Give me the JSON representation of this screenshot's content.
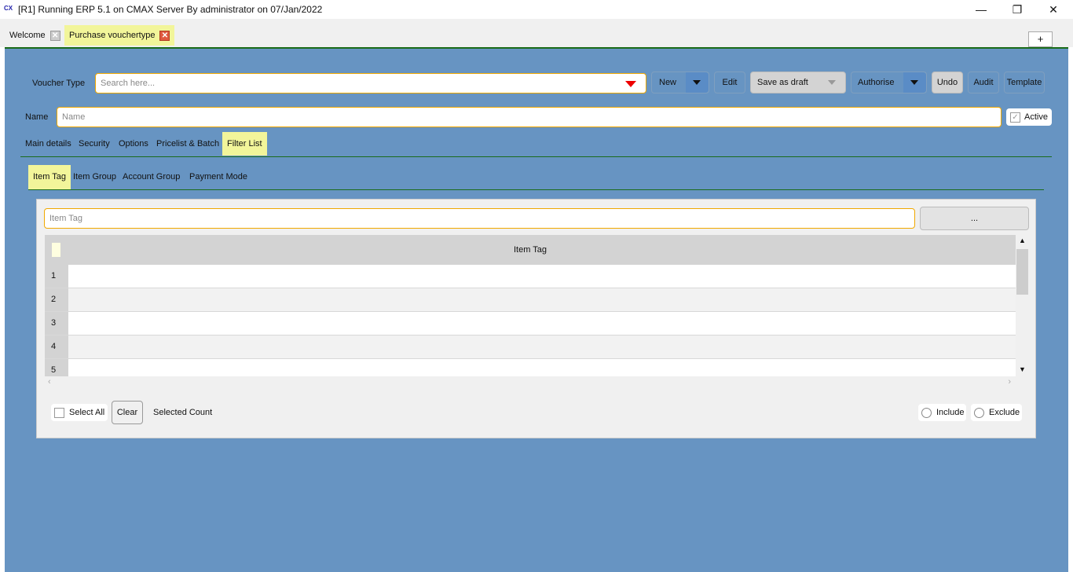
{
  "window": {
    "title": "[R1] Running ERP 5.1 on CMAX Server By administrator on 07/Jan/2022",
    "logo": "CX",
    "min": "—",
    "max": "❐",
    "close": "✕"
  },
  "tabs": [
    {
      "label": "Welcome"
    },
    {
      "label": "Purchase vouchertype"
    }
  ],
  "new_tab": "+",
  "toolbar": {
    "voucher_type_label": "Voucher Type",
    "voucher_type_placeholder": "Search here...",
    "new": "New",
    "edit": "Edit",
    "save_draft": "Save as draft",
    "authorise": "Authorise",
    "undo": "Undo",
    "audit": "Audit",
    "template": "Template"
  },
  "name_field": {
    "label": "Name",
    "placeholder": "Name",
    "active_label": "Active",
    "active_checked": true
  },
  "section_tabs": [
    "Main details",
    "Security",
    "Options",
    "Pricelist & Batch",
    "Filter List"
  ],
  "filter_tabs": [
    "Item Tag",
    "Item Group",
    "Account Group",
    "Payment Mode"
  ],
  "filter": {
    "search_placeholder": "Item Tag",
    "browse": "...",
    "column": "Item Tag",
    "rows": [
      "1",
      "2",
      "3",
      "4",
      "5"
    ],
    "select_all": "Select All",
    "clear": "Clear",
    "selected_count": "Selected Count",
    "include": "Include",
    "exclude": "Exclude"
  },
  "colors": {
    "background": "#6794c2",
    "accent_tab": "#f2f59a",
    "focus_border": "#f0a800"
  }
}
